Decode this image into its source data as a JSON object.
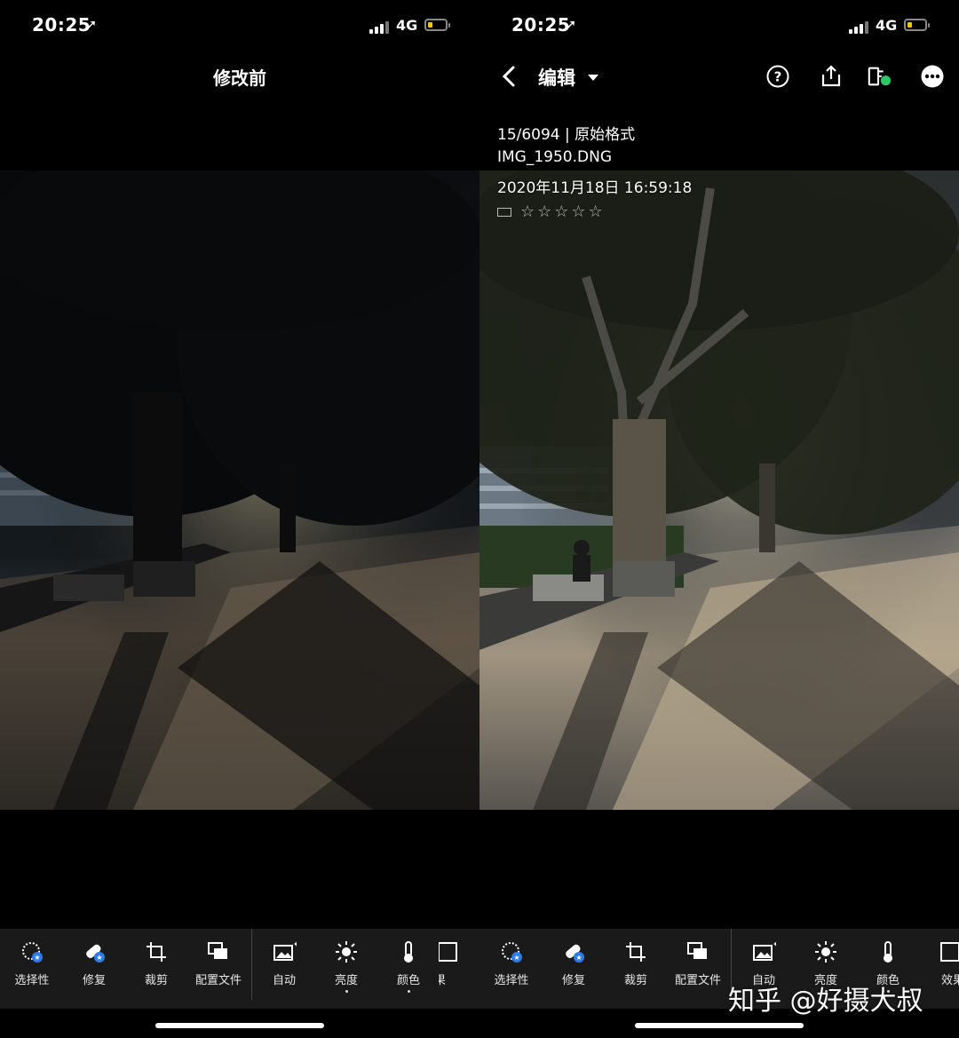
{
  "status": {
    "time": "20:25",
    "network": "4G"
  },
  "before_screen": {
    "title": "修改前"
  },
  "editor_screen": {
    "title": "编辑",
    "counter": "15/6094 | 原始格式",
    "filename": "IMG_1950.DNG",
    "datetime": "2020年11月18日 16:59:18",
    "rating_stars": 0,
    "stars": "☆☆☆☆☆"
  },
  "toolbar": {
    "items": [
      {
        "label": "选择性",
        "icon": "selective-icon"
      },
      {
        "label": "修复",
        "icon": "healing-icon"
      },
      {
        "label": "裁剪",
        "icon": "crop-icon"
      },
      {
        "label": "配置文件",
        "icon": "profiles-icon"
      },
      {
        "label": "自动",
        "icon": "auto-icon"
      },
      {
        "label": "亮度",
        "icon": "light-icon"
      },
      {
        "label": "颜色",
        "icon": "color-icon"
      },
      {
        "label": "效果",
        "icon": "effects-icon"
      }
    ],
    "right_pane_labels": [
      "选择性",
      "修复",
      "裁剪",
      "配置文件",
      "自动",
      "亮度",
      "颜色",
      "效果"
    ],
    "left_cut_label": "效果",
    "right_cut_label": "效果"
  },
  "watermark": "知乎 @好摄大叔",
  "colors": {
    "accent_badge": "#2d7be5",
    "sync_dot": "#2ec866",
    "battery": "#f5c400",
    "toolbar_bg": "#1a1a1a"
  }
}
